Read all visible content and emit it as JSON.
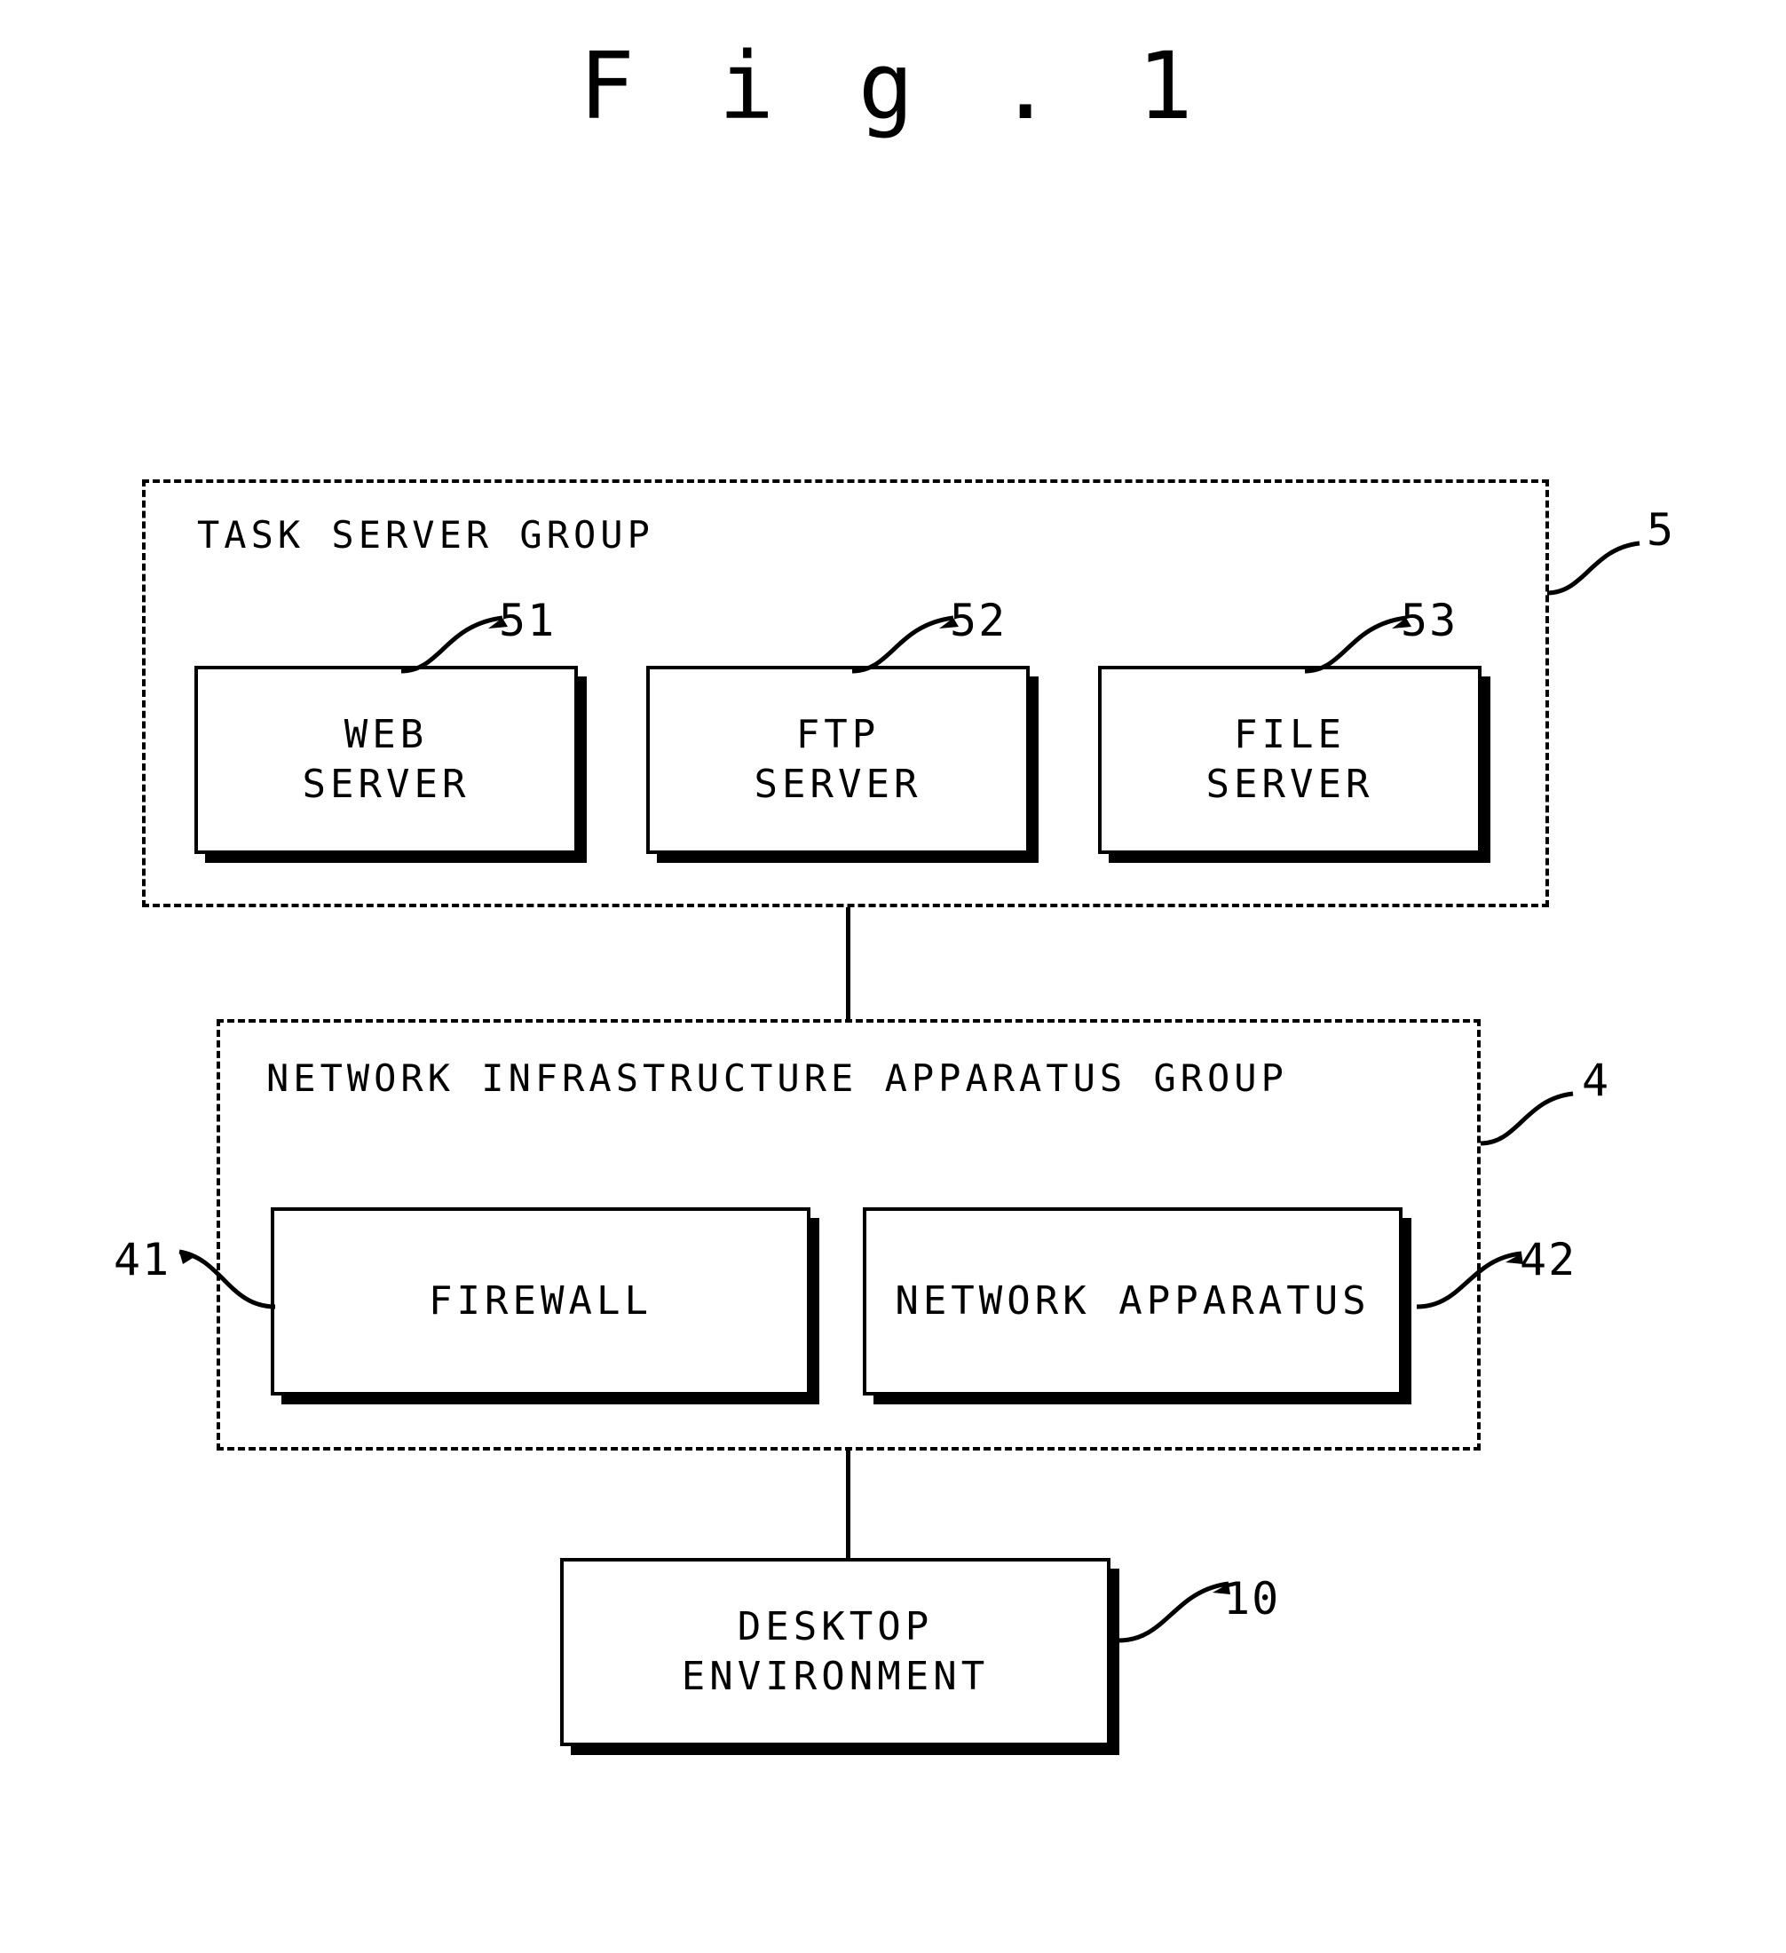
{
  "figure": {
    "title": "F i g . 1",
    "title_plain": "Fig.1"
  },
  "groups": [
    {
      "id": "task-server-group",
      "label": "TASK SERVER GROUP",
      "ref": "5"
    },
    {
      "id": "network-infrastructure-apparatus-group",
      "label": "NETWORK INFRASTRUCTURE APPARATUS GROUP",
      "ref": "4"
    }
  ],
  "nodes": [
    {
      "id": "web-server",
      "line1": "WEB",
      "line2": "SERVER",
      "ref": "51"
    },
    {
      "id": "ftp-server",
      "line1": "FTP",
      "line2": "SERVER",
      "ref": "52"
    },
    {
      "id": "file-server",
      "line1": "FILE",
      "line2": "SERVER",
      "ref": "53"
    },
    {
      "id": "firewall",
      "line1": "FIREWALL",
      "line2": "",
      "ref": "41"
    },
    {
      "id": "network-apparatus",
      "line1": "NETWORK APPARATUS",
      "line2": "",
      "ref": "42"
    },
    {
      "id": "desktop-environment",
      "line1": "DESKTOP",
      "line2": "ENVIRONMENT",
      "ref": "10"
    }
  ],
  "colors": {
    "ink": "#000000",
    "paper": "#ffffff"
  }
}
